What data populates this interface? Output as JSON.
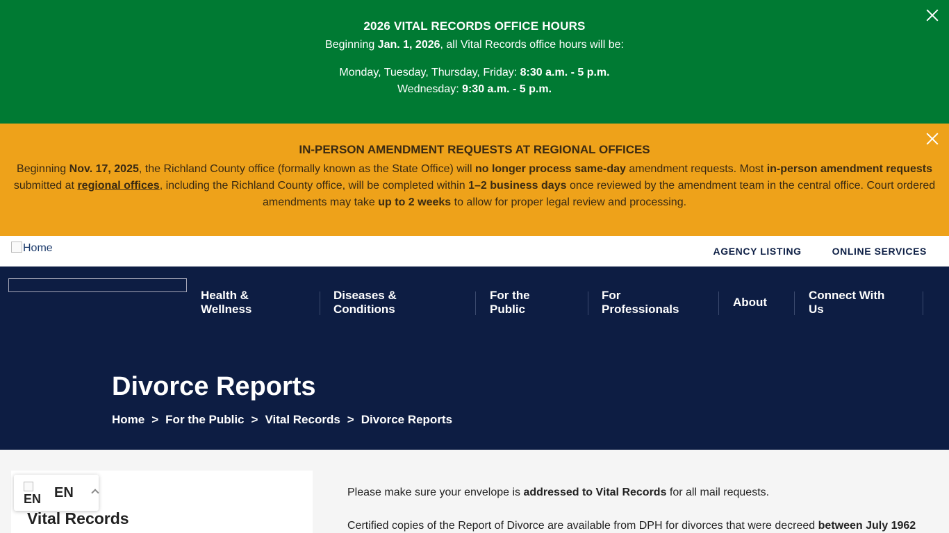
{
  "alerts": {
    "green": {
      "title": "2026 VITAL RECORDS OFFICE HOURS",
      "line1_pre": "Beginning ",
      "line1_date": "Jan. 1, 2026",
      "line1_post": ", all Vital Records office hours will be:",
      "line2_days": "Monday, Tuesday, Thursday, Friday: ",
      "line2_hours": "8:30 a.m. - 5 p.m.",
      "line3_days": "Wednesday: ",
      "line3_hours": "9:30 a.m. - 5 p.m."
    },
    "orange": {
      "title": "IN-PERSON AMENDMENT REQUESTS AT REGIONAL OFFICES",
      "t1": "Beginning ",
      "b1": "Nov. 17, 2025",
      "t2": ", the Richland County office (formally known as the State Office) will ",
      "b2": "no longer process same-day",
      "t3": " amendment requests. Most ",
      "b3": "in-person amendment requests",
      "t4": " submitted at ",
      "link": "regional offices",
      "t5": ", including the Richland County office, will be completed within ",
      "b4": "1–2 business days",
      "t6": " once reviewed by the amendment team in the central office. Court ordered amendments may take ",
      "b5": "up to 2 weeks",
      "t7": " to allow for proper legal review and processing."
    }
  },
  "topbar": {
    "home_alt": "Home",
    "links": [
      "AGENCY LISTING",
      "ONLINE SERVICES"
    ]
  },
  "nav": {
    "items": [
      {
        "line1": "Health &",
        "line2": "Wellness"
      },
      {
        "line1": "Diseases &",
        "line2": "Conditions"
      },
      {
        "line1": "For the",
        "line2": "Public"
      },
      {
        "line1": "For",
        "line2": "Professionals"
      },
      {
        "line1": "About",
        "line2": ""
      },
      {
        "line1": "Connect With",
        "line2": "Us"
      }
    ]
  },
  "hero": {
    "title": "Divorce Reports",
    "breadcrumb": [
      "Home",
      "For the Public",
      "Vital Records",
      "Divorce Reports"
    ],
    "separator": ">"
  },
  "sidebar": {
    "heading": "Vital Records"
  },
  "language": {
    "flag_text": "EN",
    "code": "EN"
  },
  "content": {
    "p1_pre": "Please make sure your envelope is ",
    "p1_bold": "addressed to Vital Records",
    "p1_post": " for all mail requests.",
    "p2_pre": "Certified copies of the Report of Divorce are available from DPH for divorces that were decreed ",
    "p2_bold": "between July 1962"
  }
}
